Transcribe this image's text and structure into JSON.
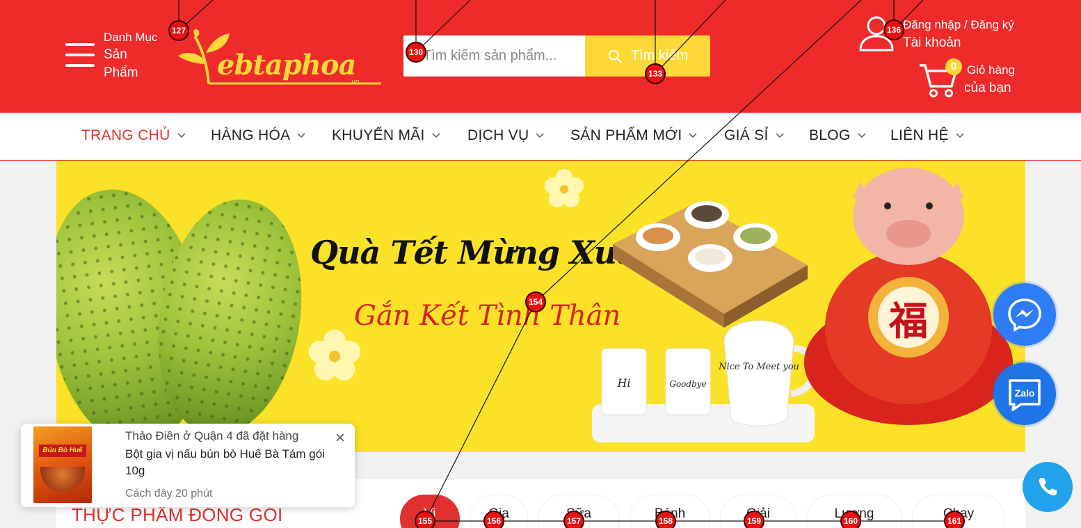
{
  "header": {
    "category_line1": "Danh Mục",
    "category_line2": "Sản",
    "category_line3": "Phẩm",
    "logo_text": "ebtaphoa",
    "logo_sub": ".vn",
    "search_placeholder": "Tìm kiếm sản phẩm...",
    "search_button": "Tìm kiếm",
    "account_line1": "Đăng nhập / Đăng ký",
    "account_line2": "Tài khoản",
    "cart_count": "0",
    "cart_line1": "Giỏ hàng",
    "cart_line2": "của bạn"
  },
  "nav": {
    "items": [
      {
        "label": "TRANG CHỦ"
      },
      {
        "label": "HÀNG HÓA"
      },
      {
        "label": "KHUYẾN MÃI"
      },
      {
        "label": "DỊCH VỤ"
      },
      {
        "label": "SẢN PHẨM MỚI"
      },
      {
        "label": "GIÁ SỈ"
      },
      {
        "label": "BLOG"
      },
      {
        "label": "LIÊN HỆ"
      }
    ]
  },
  "banner": {
    "title": "Quà Tết Mừng Xuân",
    "subtitle": "Gắn Kết Tình Thân",
    "cup1": "Hi",
    "cup2": "Goodbye",
    "teapot": "Nice To Meet you",
    "pig_char": "福"
  },
  "popup": {
    "line1": "Thảo Điền ở Quận 4 đã đặt hàng",
    "product": "Bột gia vị nấu bún bò Huế Bà Tám gói 10g",
    "time": "Cách đây 20 phút",
    "close": "×",
    "package_label": "Bún Bò Huế"
  },
  "section": {
    "title": "THỰC PHẨM ĐÓNG GÓI",
    "chips": [
      {
        "label": "Vị"
      },
      {
        "label": "Gia"
      },
      {
        "label": "Sữa"
      },
      {
        "label": "Bánh"
      },
      {
        "label": "Giải"
      },
      {
        "label": "Lương"
      },
      {
        "label": "Chay"
      }
    ]
  },
  "float": {
    "zalo_label": "Zalo"
  },
  "overlay": {
    "markers": [
      "127",
      "130",
      "133",
      "136",
      "154",
      "155",
      "156",
      "157",
      "158",
      "159",
      "160",
      "161"
    ]
  },
  "colors": {
    "brand_red": "#ee2a2a",
    "brand_yellow": "#fcd839",
    "messenger_blue": "#2e7cf6",
    "phone_blue": "#21a2ea"
  }
}
